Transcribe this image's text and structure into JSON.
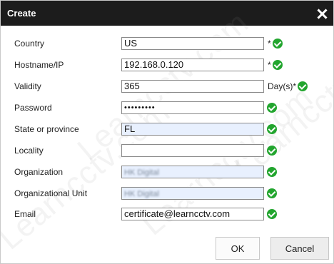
{
  "dialog": {
    "title": "Create"
  },
  "watermark": "Learncctv.com",
  "fields": [
    {
      "label": "Country",
      "value": "US",
      "suffix": "*",
      "type": "text"
    },
    {
      "label": "Hostname/IP",
      "value": "192.168.0.120",
      "suffix": "*",
      "type": "text"
    },
    {
      "label": "Validity",
      "value": "365",
      "suffix": "Day(s)*",
      "type": "text"
    },
    {
      "label": "Password",
      "value": "•••••••••",
      "suffix": "",
      "type": "password"
    },
    {
      "label": "State or province",
      "value": "FL",
      "suffix": "",
      "type": "text",
      "autofilled": true
    },
    {
      "label": "Locality",
      "value": "",
      "suffix": "",
      "type": "text"
    },
    {
      "label": "Organization",
      "value": "HK Digital",
      "suffix": "",
      "type": "text",
      "autofilled": true,
      "blurred": true
    },
    {
      "label": "Organizational Unit",
      "value": "HK Digital",
      "suffix": "",
      "type": "text",
      "autofilled": true,
      "blurred": true
    },
    {
      "label": "Email",
      "value": "certificate@learncctv.com",
      "suffix": "",
      "type": "text"
    }
  ],
  "buttons": {
    "ok": "OK",
    "cancel": "Cancel"
  },
  "colors": {
    "titlebar": "#1c1c1c",
    "valid_check": "#22a52e",
    "autofill_bg": "#e8f0fe"
  },
  "icons": {
    "close": "close-icon",
    "valid": "check-circle-icon"
  }
}
